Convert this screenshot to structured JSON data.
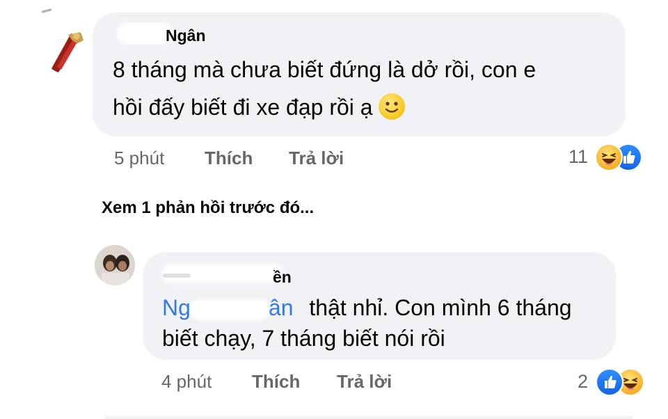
{
  "comment1": {
    "author": "Ngân",
    "lines": [
      "8 tháng mà chưa biết đứng là dở rồi, con e",
      "hồi đấy biết đi xe đạp rồi ạ"
    ],
    "emoji": "slight-smile-emoji",
    "time": "5 phút",
    "like_label": "Thích",
    "reply_label": "Trả lời",
    "reaction_count": "11",
    "reactions": [
      "haha-icon",
      "like-icon"
    ]
  },
  "view_previous": "Xem 1 phản hồi trước đó...",
  "comment2": {
    "author": "ền",
    "mention_start": "Ng",
    "mention_end": "ân",
    "line1_rest": "thật nhỉ. Con mình 6 tháng",
    "line2": "biết chạy, 7 tháng biết nói rồi",
    "time": "4 phút",
    "like_label": "Thích",
    "reply_label": "Trả lời",
    "reaction_count": "2",
    "reactions": [
      "like-icon",
      "haha-icon"
    ]
  },
  "colors": {
    "bubble": "#f0f2f5",
    "meta": "#65676b",
    "mention": "#3578e5",
    "like": "#1877f2",
    "haha": "#f7b125"
  }
}
